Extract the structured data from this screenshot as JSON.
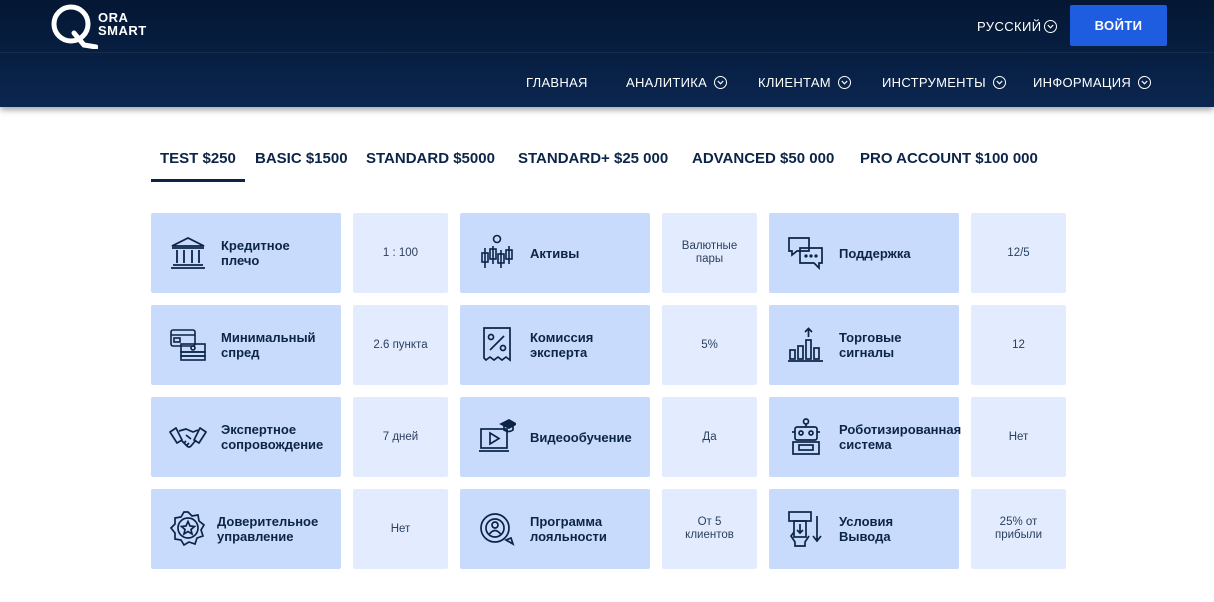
{
  "logo": {
    "letter": "Q",
    "line1": "ORA",
    "line2": "SMART"
  },
  "header": {
    "language": "РУССКИЙ",
    "login_label": "ВОЙТИ"
  },
  "nav": [
    {
      "label": "ГЛАВНАЯ"
    },
    {
      "label": "АНАЛИТИКА"
    },
    {
      "label": "КЛИЕНТАМ"
    },
    {
      "label": "ИНСТРУМЕНТЫ"
    },
    {
      "label": "ИНФОРМАЦИЯ"
    }
  ],
  "tabs": [
    {
      "label": "TEST $250",
      "active": true
    },
    {
      "label": "BASIC $1500"
    },
    {
      "label": "STANDARD $5000"
    },
    {
      "label": "STANDARD+ $25 000"
    },
    {
      "label": "ADVANCED $50 000"
    },
    {
      "label": "PRO ACCOUNT $100 000"
    }
  ],
  "features": [
    {
      "label_1": "Кредитное",
      "label_2": "плечо",
      "value_1": "1 : 100",
      "value_2": "",
      "icon": "bank-icon"
    },
    {
      "label_1": "Активы",
      "label_2": "",
      "value_1": "Валютные",
      "value_2": "пары",
      "icon": "assets-candles-icon"
    },
    {
      "label_1": "Поддержка",
      "label_2": "",
      "value_1": "12/5",
      "value_2": "",
      "icon": "chat-bubbles-icon"
    },
    {
      "label_1": "Минимальный",
      "label_2": "спред",
      "value_1": "2.6 пункта",
      "value_2": "",
      "icon": "cash-card-icon"
    },
    {
      "label_1": "Комиссия",
      "label_2": "эксперта",
      "value_1": "5%",
      "value_2": "",
      "icon": "receipt-percent-icon"
    },
    {
      "label_1": "Торговые",
      "label_2": "сигналы",
      "value_1": "12",
      "value_2": "",
      "icon": "signals-chart-icon"
    },
    {
      "label_1": "Экспертное",
      "label_2": "сопровождение",
      "value_1": "7 дней",
      "value_2": "",
      "icon": "handshake-icon"
    },
    {
      "label_1": "Видеообучение",
      "label_2": "",
      "value_1": "Да",
      "value_2": "",
      "icon": "video-course-icon"
    },
    {
      "label_1": "Роботизированная",
      "label_2": "система",
      "value_1": "Нет",
      "value_2": "",
      "icon": "robot-icon"
    },
    {
      "label_1": "Доверительное",
      "label_2": "управление",
      "value_1": "Нет",
      "value_2": "",
      "icon": "star-badge-icon"
    },
    {
      "label_1": "Программа",
      "label_2": "лояльности",
      "value_1": "От 5",
      "value_2": "клиентов",
      "icon": "loyalty-user-icon"
    },
    {
      "label_1": "Условия",
      "label_2": "Вывода",
      "value_1": "25% от",
      "value_2": "прибыли",
      "icon": "withdrawal-icon"
    }
  ],
  "colors": {
    "header_bg": "#041733",
    "accent_blue": "#1f5de0",
    "card_bg": "#c9dbfc",
    "value_bg": "#e3ecfe",
    "text_dark": "#0b2447"
  }
}
